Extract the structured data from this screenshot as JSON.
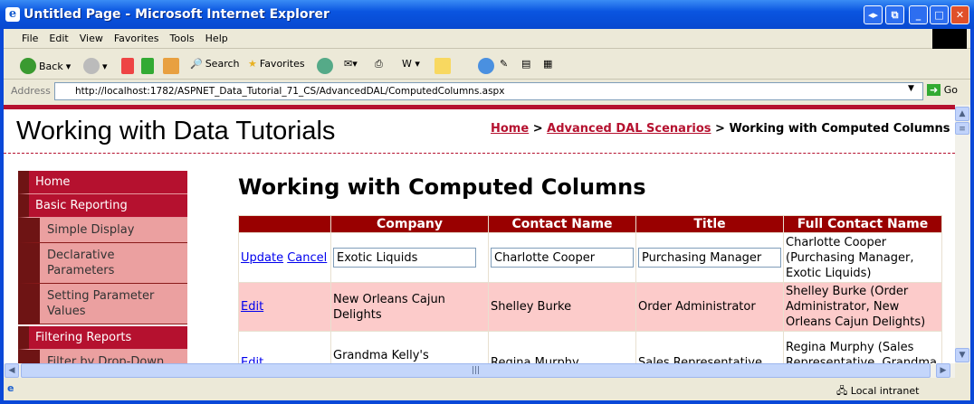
{
  "window": {
    "title": "Untitled Page - Microsoft Internet Explorer"
  },
  "menu": [
    "File",
    "Edit",
    "View",
    "Favorites",
    "Tools",
    "Help"
  ],
  "toolbar": {
    "back": "Back",
    "search": "Search",
    "favorites": "Favorites"
  },
  "address": {
    "label": "Address",
    "url": "http://localhost:1782/ASPNET_Data_Tutorial_71_CS/AdvancedDAL/ComputedColumns.aspx",
    "go": "Go"
  },
  "page": {
    "site_title": "Working with Data Tutorials",
    "breadcrumb": {
      "home": "Home",
      "sep": ">",
      "section": "Advanced DAL Scenarios",
      "current": "Working with Computed Columns"
    },
    "heading": "Working with Computed Columns"
  },
  "sidebar": {
    "items": [
      {
        "label": "Home",
        "type": "main"
      },
      {
        "label": "Basic Reporting",
        "type": "main"
      },
      {
        "label": "Simple Display",
        "type": "sub"
      },
      {
        "label": "Declarative Parameters",
        "type": "sub"
      },
      {
        "label": "Setting Parameter Values",
        "type": "sub"
      },
      {
        "label": "Filtering Reports",
        "type": "main"
      },
      {
        "label": "Filter by Drop-Down List",
        "type": "sub"
      }
    ]
  },
  "grid": {
    "headers": [
      "",
      "Company",
      "Contact Name",
      "Title",
      "Full Contact Name"
    ],
    "edit_row": {
      "update": "Update",
      "cancel": "Cancel",
      "company": "Exotic Liquids",
      "contact": "Charlotte Cooper",
      "title": "Purchasing Manager",
      "full": "Charlotte Cooper (Purchasing Manager, Exotic Liquids)"
    },
    "rows": [
      {
        "action": "Edit",
        "company": "New Orleans Cajun Delights",
        "contact": "Shelley Burke",
        "title": "Order Administrator",
        "full": "Shelley Burke (Order Administrator, New Orleans Cajun Delights)"
      },
      {
        "action": "Edit",
        "company": "Grandma Kelly's Homestead",
        "contact": "Regina Murphy",
        "title": "Sales Representative",
        "full": "Regina Murphy (Sales Representative, Grandma Kelly's Homestead)"
      }
    ]
  },
  "status": {
    "zone": "Local intranet"
  }
}
